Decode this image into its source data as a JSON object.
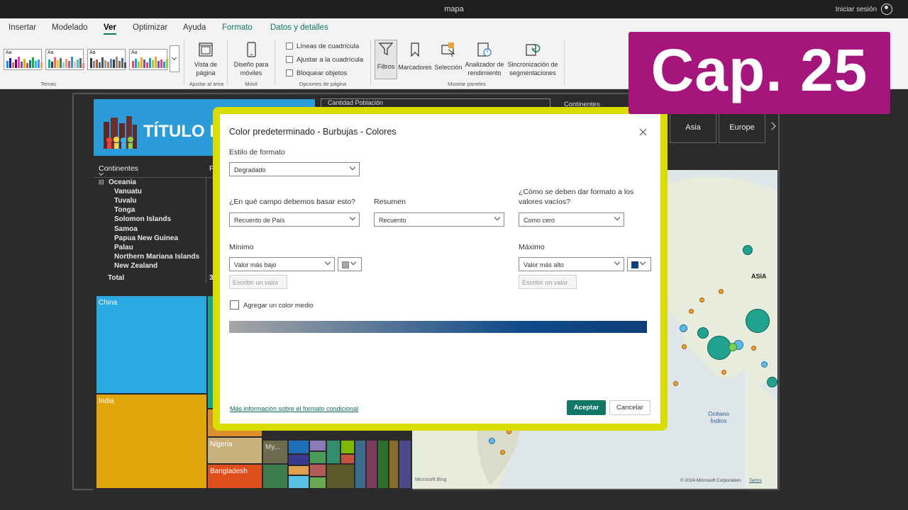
{
  "window": {
    "title": "mapa",
    "signin": "Iniciar sesión"
  },
  "menu": {
    "items": [
      "Insertar",
      "Modelado",
      "Ver",
      "Optimizar",
      "Ayuda",
      "Formato",
      "Datos y detalles"
    ],
    "active": "Ver"
  },
  "ribbon": {
    "groups": {
      "temas": "Temas",
      "ajustar": "Ajustar al área",
      "movil": "Móvil",
      "opciones": "Opciones de página",
      "paneles": "Mostrar paneles"
    },
    "vista_pagina": "Vista de página",
    "diseno_moviles": "Diseño para móviles",
    "checks": [
      "Líneas de cuadrícula",
      "Ajustar a la cuadrícula",
      "Bloquear objetos"
    ],
    "panels": [
      "Filtros",
      "Marcadores",
      "Selección",
      "Analizador de rendimiento",
      "Sincronización de segmentaciones"
    ],
    "theme_label": "Aa"
  },
  "report": {
    "title": "TÍTULO P",
    "table": {
      "header": "Continentes",
      "header2": "Po",
      "group": "Oceania",
      "rows": [
        "Vanuatu",
        "Tuvalu",
        "Tonga",
        "Solomon Islands",
        "Samoa",
        "Papua New Guinea",
        "Palau",
        "Northern Mariana Islands",
        "New Zealand"
      ],
      "total": "Total",
      "total_value": "34"
    },
    "treemap": {
      "labels": {
        "china": "China",
        "india": "India",
        "nigeria": "Nigeria",
        "bangladesh": "Bangladesh",
        "my": "My..."
      }
    },
    "slicer_title": "Cantidad Población",
    "continents_label": "Continentes",
    "continent_buttons": [
      "Asia",
      "Europe"
    ],
    "map": {
      "asia": "ASIA",
      "ocean": "Océano Índico",
      "bing": "Microsoft Bing",
      "copyright": "© 2024 Microsoft Corporation",
      "terms": "Terms"
    }
  },
  "dialog": {
    "title": "Color predeterminado - Burbujas - Colores",
    "estilo_label": "Estilo de formato",
    "estilo_value": "Degradado",
    "campo_label": "¿En qué campo debemos basar esto?",
    "campo_value": "Recuento de País",
    "resumen_label": "Resumen",
    "resumen_value": "Recuento",
    "vacios_label_1": "¿Cómo se deben dar formato a los",
    "vacios_label_2": "valores vacíos?",
    "vacios_value": "Como cero",
    "minimo_label": "Mínimo",
    "minimo_value": "Valor más bajo",
    "maximo_label": "Máximo",
    "maximo_value": "Valor más alto",
    "escribir_placeholder": "Escribir un valor",
    "color_medio_label": "Agregar un color medio",
    "min_color": "#a6a6a6",
    "max_color": "#0f3f7a",
    "link": "Más información sobre el formato condicional",
    "accept": "Aceptar",
    "cancel": "Cancelar"
  },
  "badge": {
    "text": "Cap. 25"
  }
}
